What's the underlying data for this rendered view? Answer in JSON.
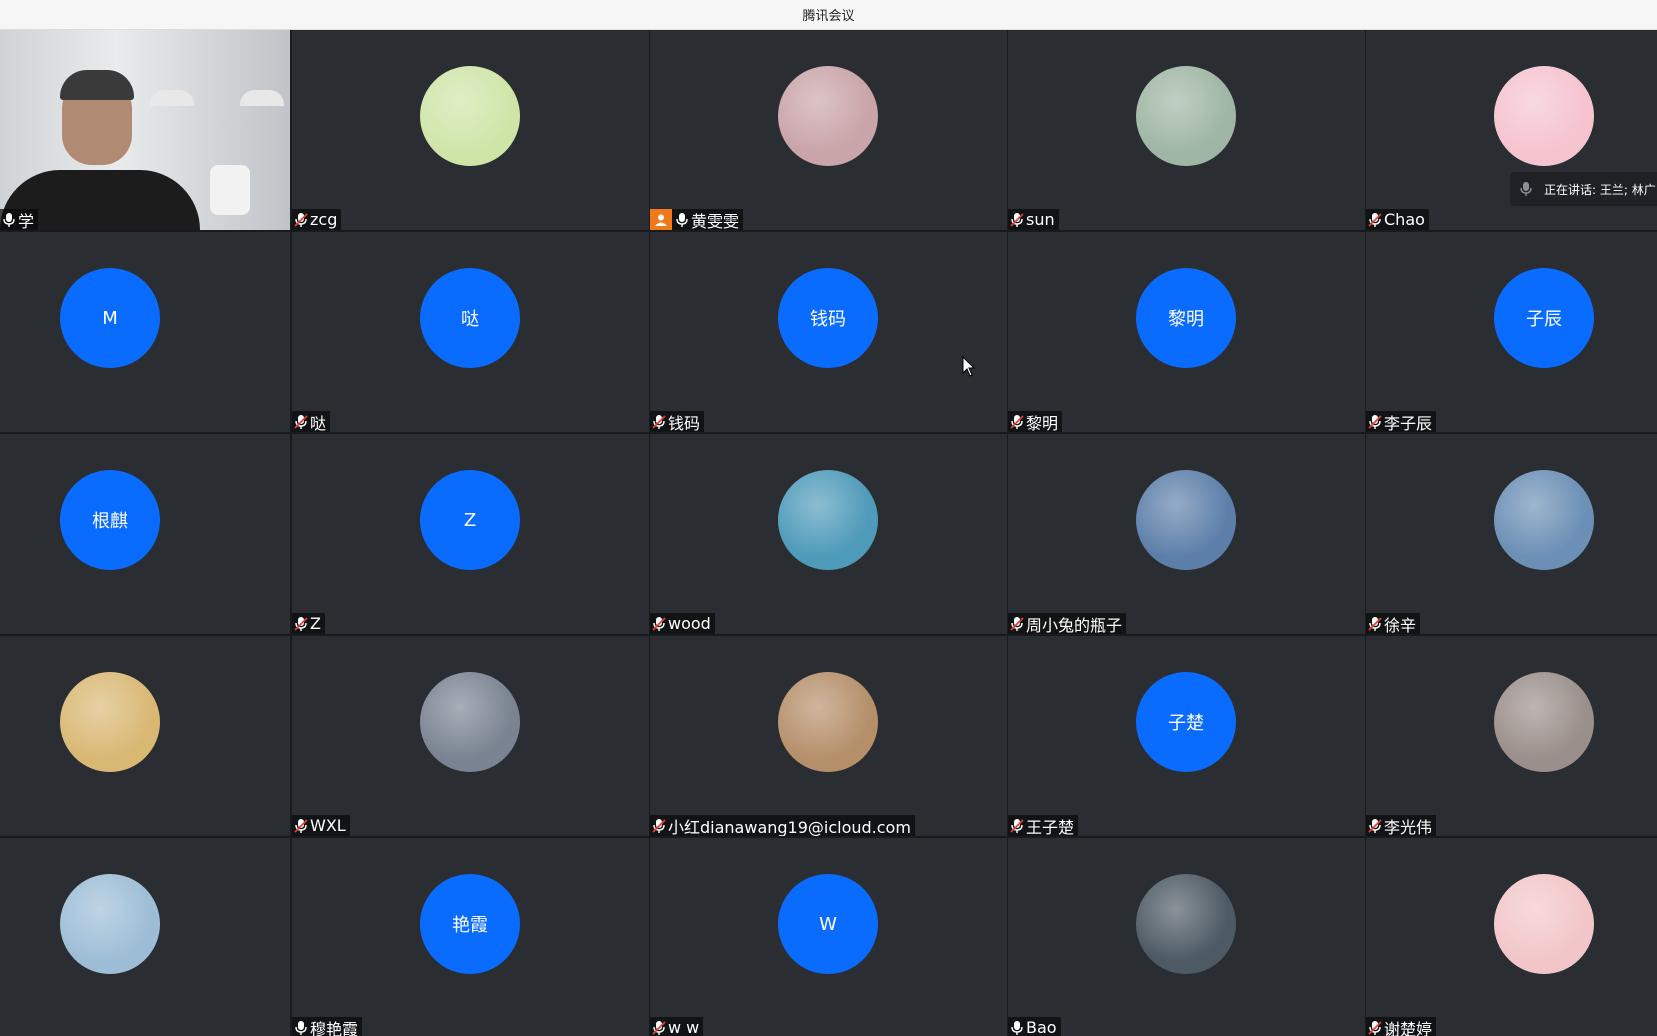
{
  "window": {
    "title": "腾讯会议"
  },
  "speaking": {
    "label": "正在讲话: 王兰; 林广"
  },
  "accent": "#0a6cff",
  "participants": [
    {
      "name": "学",
      "kind": "video",
      "muted": false
    },
    {
      "name": "zcg",
      "kind": "photo",
      "icon": "duck-avatar",
      "bg": "#cfe5a8",
      "muted": true
    },
    {
      "name": "黄雯雯",
      "kind": "photo",
      "icon": "anime-girl-avatar",
      "bg": "#c9a4a8",
      "muted": false,
      "host": true
    },
    {
      "name": "sun",
      "kind": "photo",
      "icon": "sleeping-puppy-avatar",
      "bg": "#9fb6a4",
      "muted": true
    },
    {
      "name": "Chao",
      "kind": "photo",
      "icon": "pink-blob-avatar",
      "bg": "#f5c4cf",
      "muted": true
    },
    {
      "name": "",
      "initials": "M",
      "kind": "initials",
      "muted": false
    },
    {
      "name": "哒",
      "initials": "哒",
      "kind": "initials",
      "muted": true
    },
    {
      "name": "钱码",
      "initials": "钱码",
      "kind": "initials",
      "muted": true
    },
    {
      "name": "黎明",
      "initials": "黎明",
      "kind": "initials",
      "muted": true
    },
    {
      "name": "李子辰",
      "initials": "子辰",
      "kind": "initials",
      "muted": true
    },
    {
      "name": "",
      "initials": "根麒",
      "kind": "initials",
      "muted": false
    },
    {
      "name": "Z",
      "initials": "Z",
      "kind": "initials",
      "muted": true
    },
    {
      "name": "wood",
      "kind": "photo",
      "icon": "beach-avatar",
      "bg": "#4e9ab9",
      "muted": true
    },
    {
      "name": "周小兔的瓶子",
      "kind": "photo",
      "icon": "temple-avatar",
      "bg": "#5c7fa9",
      "muted": true
    },
    {
      "name": "徐辛",
      "kind": "photo",
      "icon": "seaside-avatar",
      "bg": "#6b8fb5",
      "muted": true
    },
    {
      "name": "",
      "kind": "photo",
      "icon": "sunflower-girl-avatar",
      "bg": "#d9b874",
      "muted": false
    },
    {
      "name": "WXL",
      "kind": "photo",
      "icon": "city-aerial-avatar",
      "bg": "#7a8391",
      "muted": true
    },
    {
      "name": "小红dianawang19@icloud.com",
      "kind": "photo",
      "icon": "cake-avatar",
      "bg": "#b58f6a",
      "muted": true
    },
    {
      "name": "王子楚",
      "initials": "子楚",
      "kind": "initials",
      "muted": true
    },
    {
      "name": "李光伟",
      "kind": "photo",
      "icon": "yawning-man-avatar",
      "bg": "#9a8f8a",
      "muted": true
    },
    {
      "name": "",
      "kind": "photo",
      "icon": "sky-tree-avatar",
      "bg": "#9dbdd6",
      "muted": false
    },
    {
      "name": "穆艳霞",
      "initials": "艳霞",
      "kind": "initials",
      "muted": false
    },
    {
      "name": "w w",
      "initials": "W",
      "kind": "initials",
      "muted": true
    },
    {
      "name": "Bao",
      "kind": "photo",
      "icon": "lake-avatar",
      "bg": "#4d5963",
      "muted": false
    },
    {
      "name": "谢楚婷",
      "kind": "photo",
      "icon": "sleeping-anime-avatar",
      "bg": "#f2c6c9",
      "muted": true
    }
  ]
}
